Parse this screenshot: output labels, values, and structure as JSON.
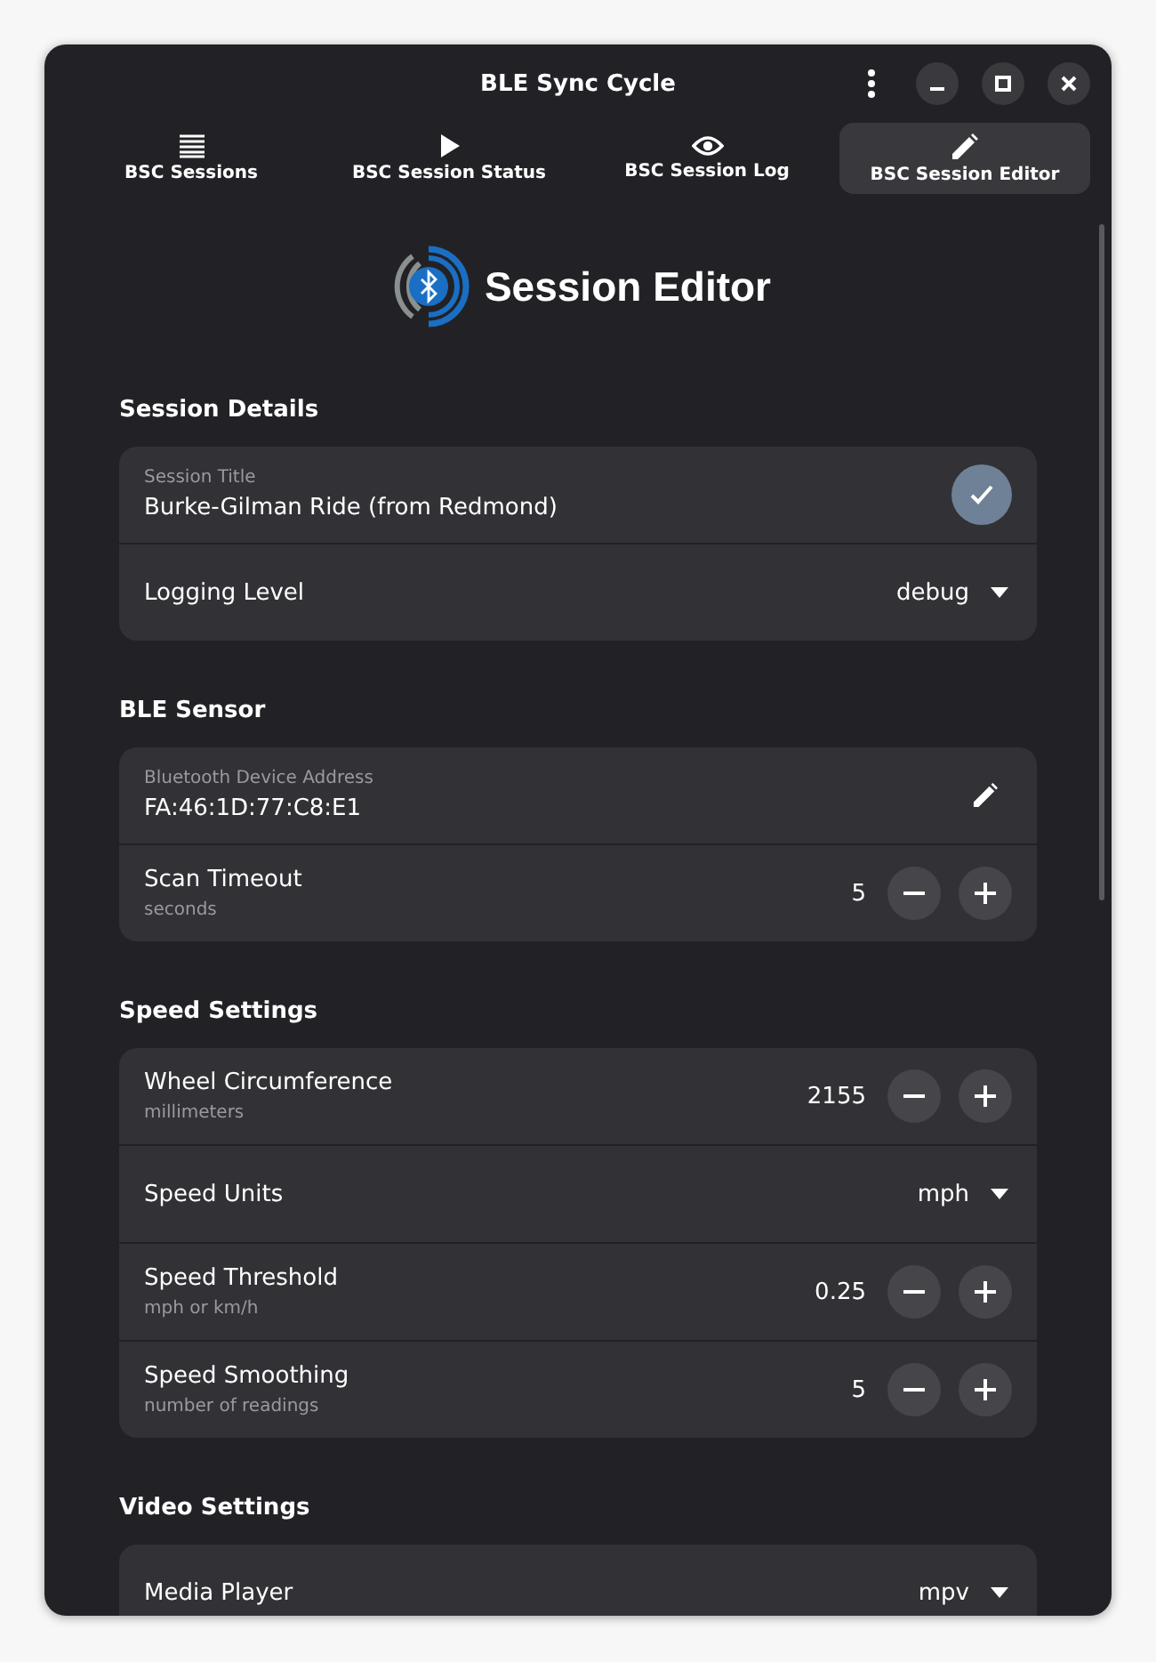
{
  "window": {
    "title": "BLE Sync Cycle"
  },
  "tabs": [
    {
      "label": "BSC Sessions",
      "selected": false
    },
    {
      "label": "BSC Session Status",
      "selected": false
    },
    {
      "label": "BSC Session Log",
      "selected": false
    },
    {
      "label": "BSC Session Editor",
      "selected": true
    }
  ],
  "page_title": "Session Editor",
  "sections": [
    {
      "title": "Session Details",
      "rows": [
        {
          "kind": "confirmentry",
          "caption": "Session Title",
          "value": "Burke-Gilman Ride (from Redmond)"
        },
        {
          "kind": "dropdown",
          "label": "Logging Level",
          "value": "debug"
        }
      ]
    },
    {
      "title": "BLE Sensor",
      "rows": [
        {
          "kind": "editentry",
          "caption": "Bluetooth Device Address",
          "value": "FA:46:1D:77:C8:E1"
        },
        {
          "kind": "spin",
          "label": "Scan Timeout",
          "subtitle": "seconds",
          "value": "5"
        }
      ]
    },
    {
      "title": "Speed Settings",
      "rows": [
        {
          "kind": "spin",
          "label": "Wheel Circumference",
          "subtitle": "millimeters",
          "value": "2155"
        },
        {
          "kind": "dropdown",
          "label": "Speed Units",
          "value": "mph"
        },
        {
          "kind": "spin",
          "label": "Speed Threshold",
          "subtitle": "mph or km/h",
          "value": "0.25"
        },
        {
          "kind": "spin",
          "label": "Speed Smoothing",
          "subtitle": "number of readings",
          "value": "5"
        }
      ]
    },
    {
      "title": "Video Settings",
      "rows": [
        {
          "kind": "dropdown",
          "label": "Media Player",
          "value": "mpv"
        }
      ]
    }
  ]
}
